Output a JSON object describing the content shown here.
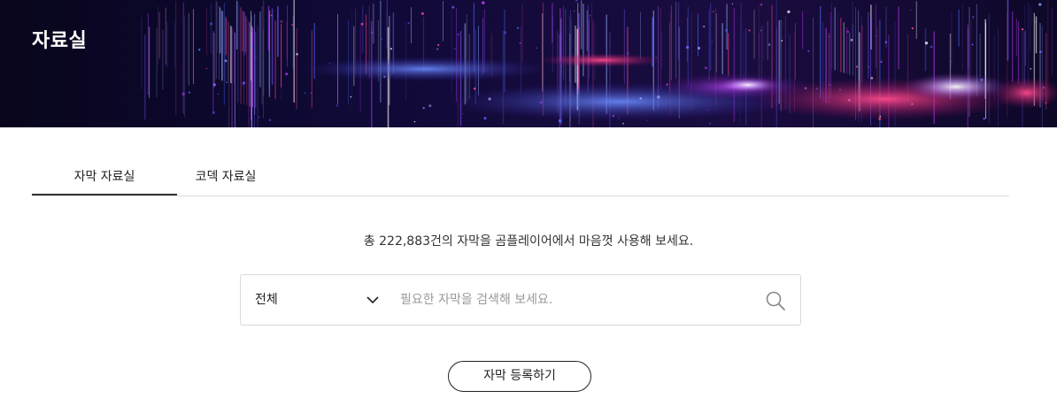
{
  "header": {
    "title": "자료실",
    "banner_colors": [
      "#0b0726",
      "#2a1a8a",
      "#4a6aff",
      "#c03cff",
      "#ff2a6a",
      "#ffffff"
    ]
  },
  "tabs": [
    {
      "label": "자막 자료실",
      "active": true
    },
    {
      "label": "코덱 자료실",
      "active": false
    }
  ],
  "summary": {
    "text": "총 222,883건의 자막을 곰플레이어에서 마음껏 사용해 보세요."
  },
  "search": {
    "category": "전체",
    "category_icon": "chevron-down-icon",
    "placeholder": "필요한 자막을 검색해 보세요.",
    "value": "",
    "button_icon": "search-icon"
  },
  "register_button": {
    "label": "자막 등록하기"
  }
}
